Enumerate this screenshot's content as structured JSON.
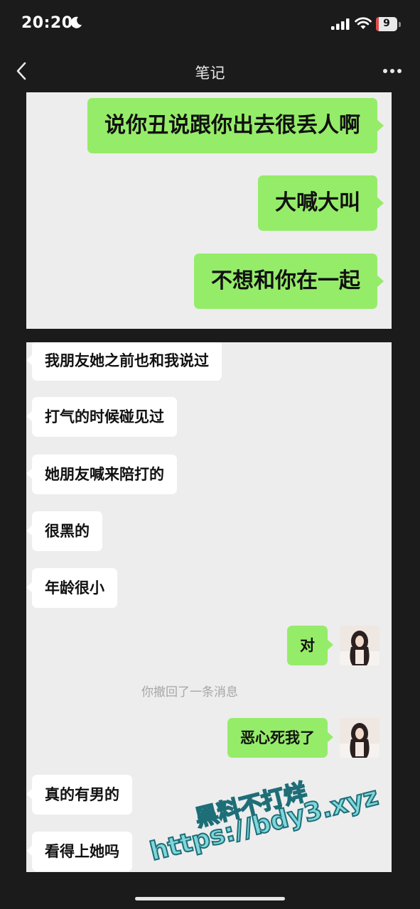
{
  "status_bar": {
    "time": "20:20",
    "battery": "9"
  },
  "nav": {
    "title": "笔记"
  },
  "card1": {
    "messages": [
      {
        "text": "说你丑说跟你出去很丢人啊"
      },
      {
        "text": "大喊大叫"
      },
      {
        "text": "不想和你在一起"
      }
    ]
  },
  "card2": {
    "messages": [
      {
        "text": "我朋友她之前也和我说过"
      },
      {
        "text": "打气的时候碰见过"
      },
      {
        "text": "她朋友喊来陪打的"
      },
      {
        "text": "很黑的"
      },
      {
        "text": "年龄很小"
      },
      {
        "text": "对"
      },
      {
        "text": "恶心死我了"
      },
      {
        "text": "真的有男的"
      },
      {
        "text": "看得上她吗"
      }
    ],
    "recall_notice": "你撤回了一条消息"
  },
  "watermark": {
    "line1": "黑料不打烊",
    "line2": "https://bdy3.xyz"
  },
  "colors": {
    "sent_bubble": "#95ec69",
    "received_bubble": "#ffffff",
    "card_bg": "#ededed",
    "page_bg": "#1b1b1b"
  }
}
